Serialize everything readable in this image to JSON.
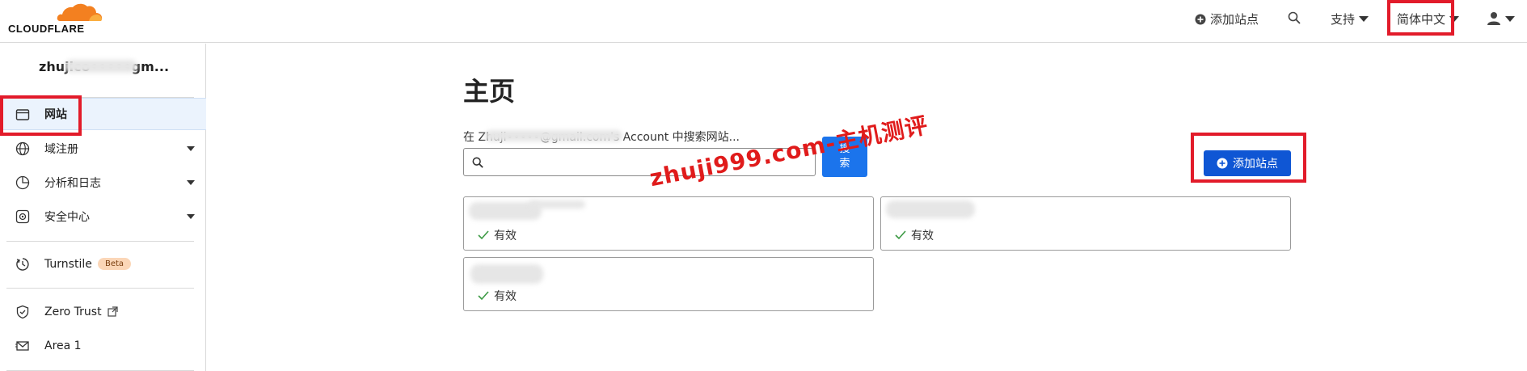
{
  "header": {
    "logo_text": "CLOUDFLARE",
    "add_site": "添加站点",
    "support": "支持",
    "language": "简体中文"
  },
  "sidebar": {
    "account": "zhujico•••••gm...",
    "items": [
      {
        "label": "网站",
        "icon": "browser-window-icon"
      },
      {
        "label": "域注册",
        "icon": "globe-icon"
      },
      {
        "label": "分析和日志",
        "icon": "pie-chart-icon"
      },
      {
        "label": "安全中心",
        "icon": "security-center-icon"
      },
      {
        "label": "Turnstile",
        "icon": "turnstile-icon",
        "badge": "Beta"
      },
      {
        "label": "Zero Trust",
        "icon": "zero-trust-shield-icon"
      },
      {
        "label": "Area 1",
        "icon": "mail-icon"
      }
    ]
  },
  "main": {
    "title": "主页",
    "search_label": "在 Zhuji•••••@gmail.com's Account 中搜索网站...",
    "search_placeholder": "",
    "search_button": "搜索",
    "search_button_line1": "搜",
    "search_button_line2": "索",
    "add_site_button": "添加站点",
    "watermark": "zhuji999.com-主机测评",
    "sites": [
      {
        "status": "有效"
      },
      {
        "status": "有效"
      },
      {
        "status": "有效"
      }
    ]
  },
  "colors": {
    "accent": "#0f56d4",
    "search_button": "#1b74ec",
    "highlight": "#e21b2a",
    "cloud_orange": "#f38020",
    "status_check": "#3c9a44"
  }
}
